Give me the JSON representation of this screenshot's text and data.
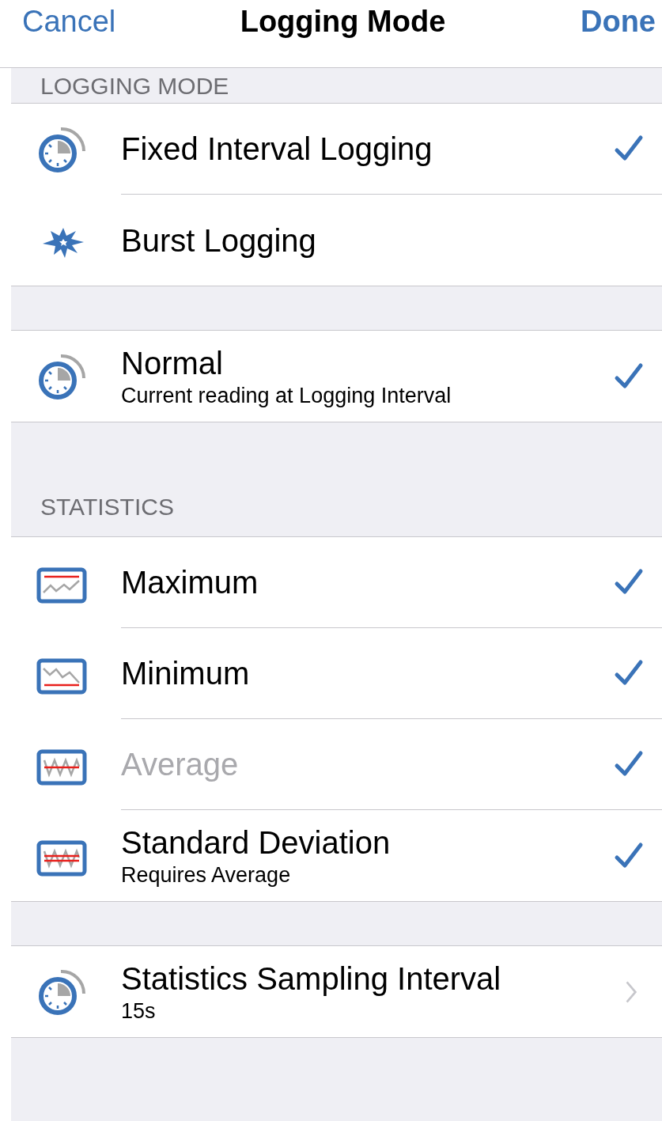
{
  "nav": {
    "cancel": "Cancel",
    "title": "Logging Mode",
    "done": "Done"
  },
  "sections": [
    {
      "header": "LOGGING MODE",
      "rows": [
        {
          "kind": "timer",
          "title": "Fixed Interval Logging",
          "checked": true,
          "disabled": false
        },
        {
          "kind": "burst",
          "title": "Burst Logging",
          "checked": false,
          "disabled": false
        }
      ]
    },
    {
      "rows": [
        {
          "kind": "timer",
          "title": "Normal",
          "subtitle": "Current reading at Logging Interval",
          "checked": true,
          "disabled": false
        }
      ]
    },
    {
      "header": "STATISTICS",
      "rows": [
        {
          "kind": "maximum",
          "title": "Maximum",
          "checked": true,
          "disabled": false
        },
        {
          "kind": "minimum",
          "title": "Minimum",
          "checked": true,
          "disabled": false
        },
        {
          "kind": "average",
          "title": "Average",
          "checked": true,
          "disabled": true
        },
        {
          "kind": "deviation",
          "title": "Standard Deviation",
          "subtitle": "Requires Average",
          "checked": true,
          "disabled": false
        }
      ]
    },
    {
      "rows": [
        {
          "kind": "timer",
          "title": "Statistics Sampling Interval",
          "subtitle": "15s",
          "disabled": false
        }
      ]
    }
  ]
}
